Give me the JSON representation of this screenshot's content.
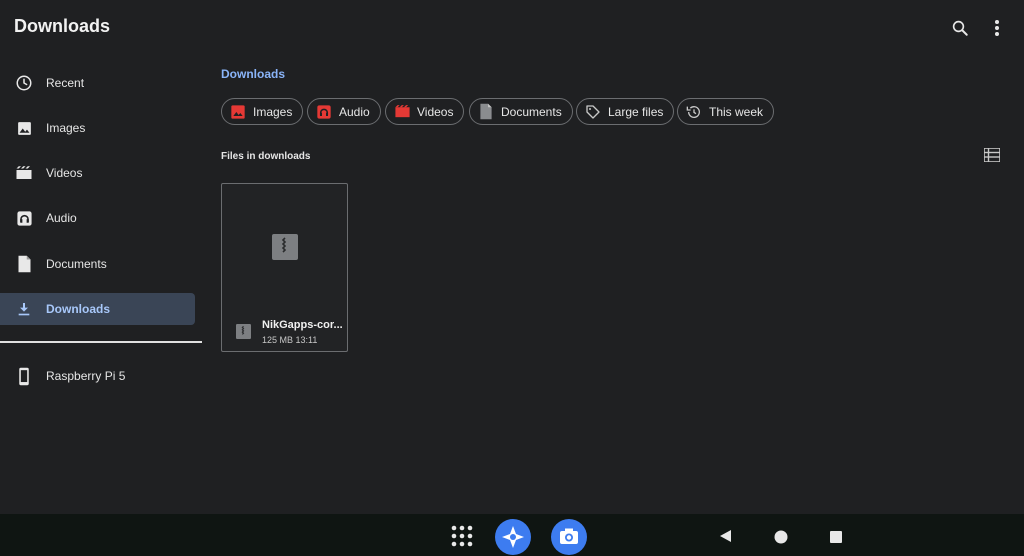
{
  "header": {
    "title": "Downloads",
    "icons": [
      "search-icon",
      "more-vert-icon"
    ]
  },
  "sidebar": {
    "items": [
      {
        "label": "Recent",
        "icon": "clock-icon"
      },
      {
        "label": "Images",
        "icon": "image-icon"
      },
      {
        "label": "Videos",
        "icon": "movie-icon"
      },
      {
        "label": "Audio",
        "icon": "audio-icon"
      },
      {
        "label": "Documents",
        "icon": "document-icon"
      },
      {
        "label": "Downloads",
        "icon": "download-icon",
        "active": true
      }
    ],
    "devices": [
      {
        "label": "Raspberry Pi 5",
        "icon": "phone-icon"
      }
    ]
  },
  "main": {
    "breadcrumb": "Downloads",
    "chips": [
      {
        "label": "Images",
        "icon": "image-icon",
        "color": "#e53935"
      },
      {
        "label": "Audio",
        "icon": "audio-icon",
        "color": "#e53935"
      },
      {
        "label": "Videos",
        "icon": "movie-icon",
        "color": "#e53935"
      },
      {
        "label": "Documents",
        "icon": "document-icon",
        "color": "#8a8c8f"
      },
      {
        "label": "Large files",
        "icon": "tag-icon",
        "color": "#c8c8c8"
      },
      {
        "label": "This week",
        "icon": "history-icon",
        "color": "#c8c8c8"
      }
    ],
    "section_title": "Files in downloads",
    "files": [
      {
        "name": "NikGapps-cor...",
        "size": "125 MB",
        "time": "13:11",
        "icon": "zip-icon"
      }
    ]
  },
  "navbar": {
    "buttons": [
      "apps-grid-icon",
      "assistant-icon",
      "camera-icon",
      "back-icon",
      "home-icon",
      "recents-icon"
    ]
  },
  "colors": {
    "background": "#1f2022",
    "accent": "#8ab4f8",
    "active_bg": "#3a4556",
    "nav_bg": "#0f1512",
    "assistant_blue": "#3d7cf0"
  }
}
